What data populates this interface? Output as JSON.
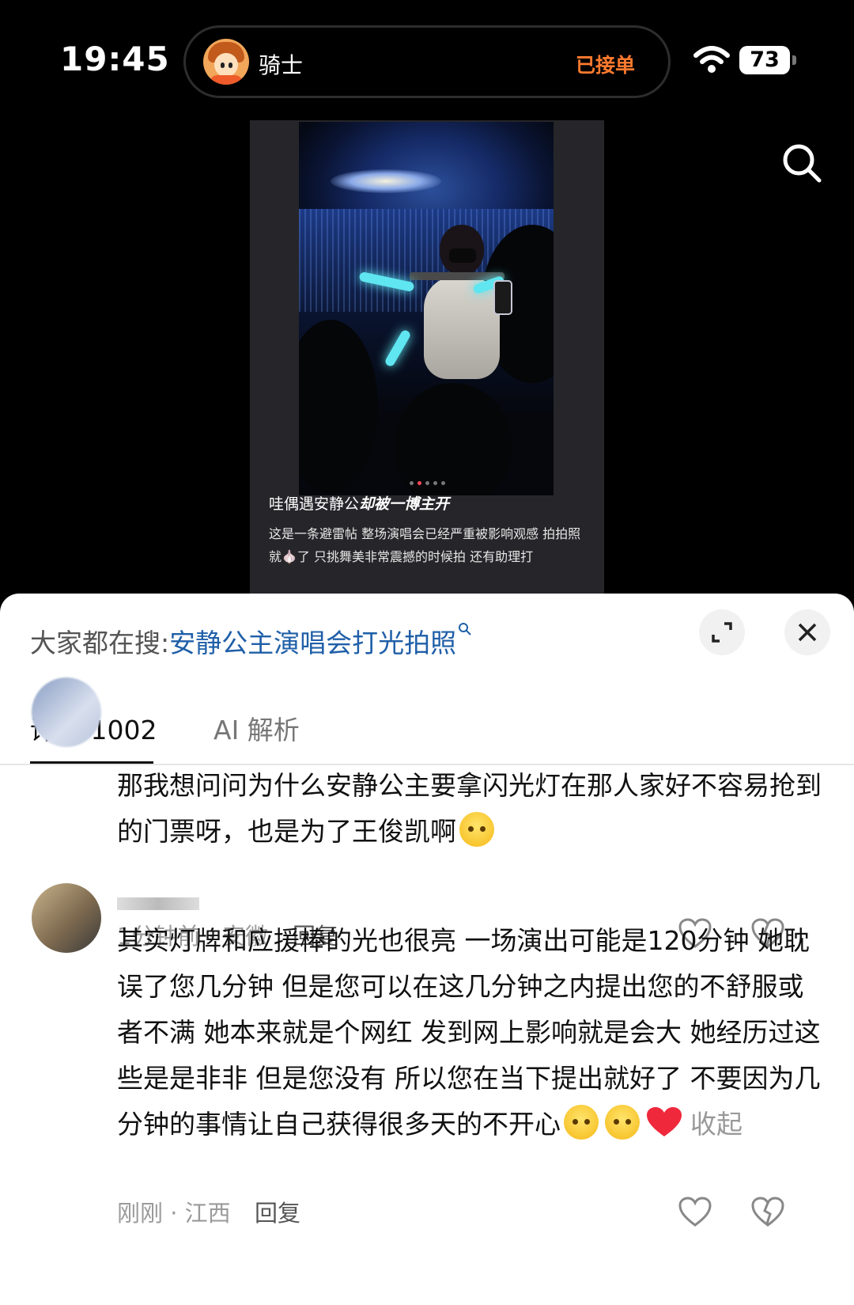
{
  "status_bar": {
    "time": "19:45",
    "island_title": "骑士",
    "island_status": "已接单",
    "battery_level": "73"
  },
  "post": {
    "caption_title_plain": "哇偶遇安静公",
    "caption_title_emph": "却被一博主开",
    "caption_body": "这是一条避雷帖 整场演唱会已经严重被影响观感 拍拍照就🧄了 只挑舞美非常震撼的时候拍 还有助理打",
    "image_count": 5,
    "active_image_index": 1
  },
  "sheet": {
    "trending_prefix": "大家都在搜:",
    "trending_query": "安静公主演唱会打光拍照",
    "tabs": [
      {
        "label": "评论 1002",
        "selected": true
      },
      {
        "label": "AI 解析",
        "selected": false
      }
    ]
  },
  "comments": [
    {
      "text": "那我想问问为什么安静公主要拿闪光灯在那人家好不容易抢到的门票呀，也是为了王俊凯啊",
      "time": "1分钟前",
      "region": "安徽",
      "reply_label": "回复"
    },
    {
      "text": "其实灯牌和应援棒的光也很亮 一场演出可能是120分钟 她耽误了您几分钟 但是您可以在这几分钟之内提出您的不舒服或者不满 她本来就是个网红 发到网上影响就是会大 她经历过这些是是非非 但是您没有 所以您在当下提出就好了 不要因为几分钟的事情让自己获得很多天的不开心",
      "collapse_label": "收起",
      "time": "刚刚",
      "region": "江西",
      "reply_label": "回复"
    }
  ],
  "colors": {
    "order_status": "#ff7a2e",
    "trending_query": "#1f5fa8",
    "meta_text": "#9a9a9a"
  },
  "icons": [
    "wifi-icon",
    "battery-icon",
    "search-icon",
    "expand-icon",
    "close-icon",
    "heart-like-icon",
    "broken-heart-dislike-icon",
    "red-heart-emoji"
  ]
}
